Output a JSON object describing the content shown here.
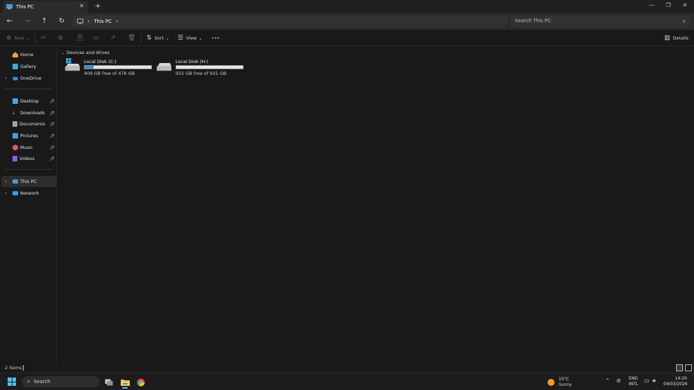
{
  "window": {
    "tab_title": "This PC",
    "tab_close": "✕",
    "new_tab": "+",
    "minimize": "—",
    "maximize": "❐",
    "close": "✕"
  },
  "nav": {
    "back": "←",
    "forward": "→",
    "up": "↑",
    "refresh": "↻"
  },
  "address": {
    "crumbs": [
      "This PC"
    ],
    "search_placeholder": "Search This PC"
  },
  "commandbar": {
    "new_label": "New",
    "sort_label": "Sort",
    "view_label": "View",
    "more_label": "•••",
    "details_label": "Details"
  },
  "sidebar": {
    "items": [
      {
        "label": "Home",
        "icon": "home-icon"
      },
      {
        "label": "Gallery",
        "icon": "gallery-icon"
      },
      {
        "label": "OneDrive",
        "icon": "onedrive-icon"
      },
      {
        "label": "Desktop",
        "icon": "desktop-icon",
        "pinned": true
      },
      {
        "label": "Downloads",
        "icon": "downloads-icon",
        "pinned": true
      },
      {
        "label": "Documents",
        "icon": "documents-icon",
        "pinned": true
      },
      {
        "label": "Pictures",
        "icon": "pictures-icon",
        "pinned": true
      },
      {
        "label": "Music",
        "icon": "music-icon",
        "pinned": true
      },
      {
        "label": "Videos",
        "icon": "videos-icon",
        "pinned": true
      },
      {
        "label": "This PC",
        "icon": "this-pc-icon",
        "selected": true
      },
      {
        "label": "Network",
        "icon": "network-icon"
      }
    ]
  },
  "main": {
    "group_title": "Devices and drives",
    "drives": [
      {
        "name": "Local Disk (C:)",
        "free_text": "409 GB free of 476 GB",
        "used_fraction": 0.14
      },
      {
        "name": "Local Disk (H:)",
        "free_text": "931 GB free of 931 GB",
        "used_fraction": 0.0
      }
    ]
  },
  "status": {
    "item_count": "2 items"
  },
  "taskbar": {
    "search_label": "Search",
    "weather_temp": "15°C",
    "weather_cond": "Sunny",
    "lang_top": "ENG",
    "lang_bottom": "INTL",
    "time": "14:20",
    "date": "04/03/2026"
  },
  "colors": {
    "accent": "#4cc2ff",
    "drive_fill": "#2f8fe6",
    "background": "#191919"
  }
}
